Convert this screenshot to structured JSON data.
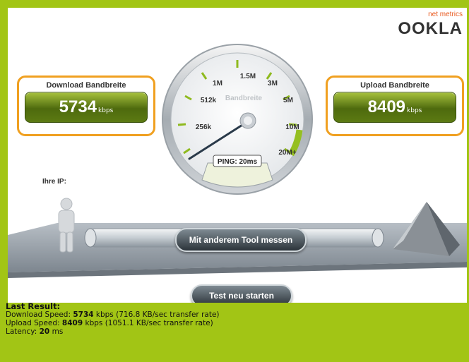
{
  "logo": {
    "small": "net metrics",
    "big": "OOKLA"
  },
  "download": {
    "title": "Download Bandbreite",
    "value": "5734",
    "unit": "kbps"
  },
  "upload": {
    "title": "Upload Bandbreite",
    "value": "8409",
    "unit": "kbps"
  },
  "gauge": {
    "label": "Bandbreite",
    "ticks": [
      "256k",
      "512k",
      "1M",
      "1.5M",
      "3M",
      "5M",
      "10M",
      "20M+"
    ],
    "ping": "PING: 20ms"
  },
  "ip": {
    "label": "Ihre IP:"
  },
  "buttons": {
    "other_tool": "Mit anderem Tool messen",
    "restart": "Test neu starten"
  },
  "last_result": {
    "title": "Last Result:",
    "download_prefix": "Download Speed: ",
    "download_value": "5734",
    "download_suffix": " kbps (716.8 KB/sec transfer rate)",
    "upload_prefix": "Upload Speed: ",
    "upload_value": "8409",
    "upload_suffix": " kbps (1051.1 KB/sec transfer rate)",
    "latency_prefix": "Latency: ",
    "latency_value": "20",
    "latency_suffix": " ms"
  },
  "colors": {
    "accent_green": "#a2c515",
    "orange_border": "#f0a020",
    "button_dark": "#2c343a"
  }
}
